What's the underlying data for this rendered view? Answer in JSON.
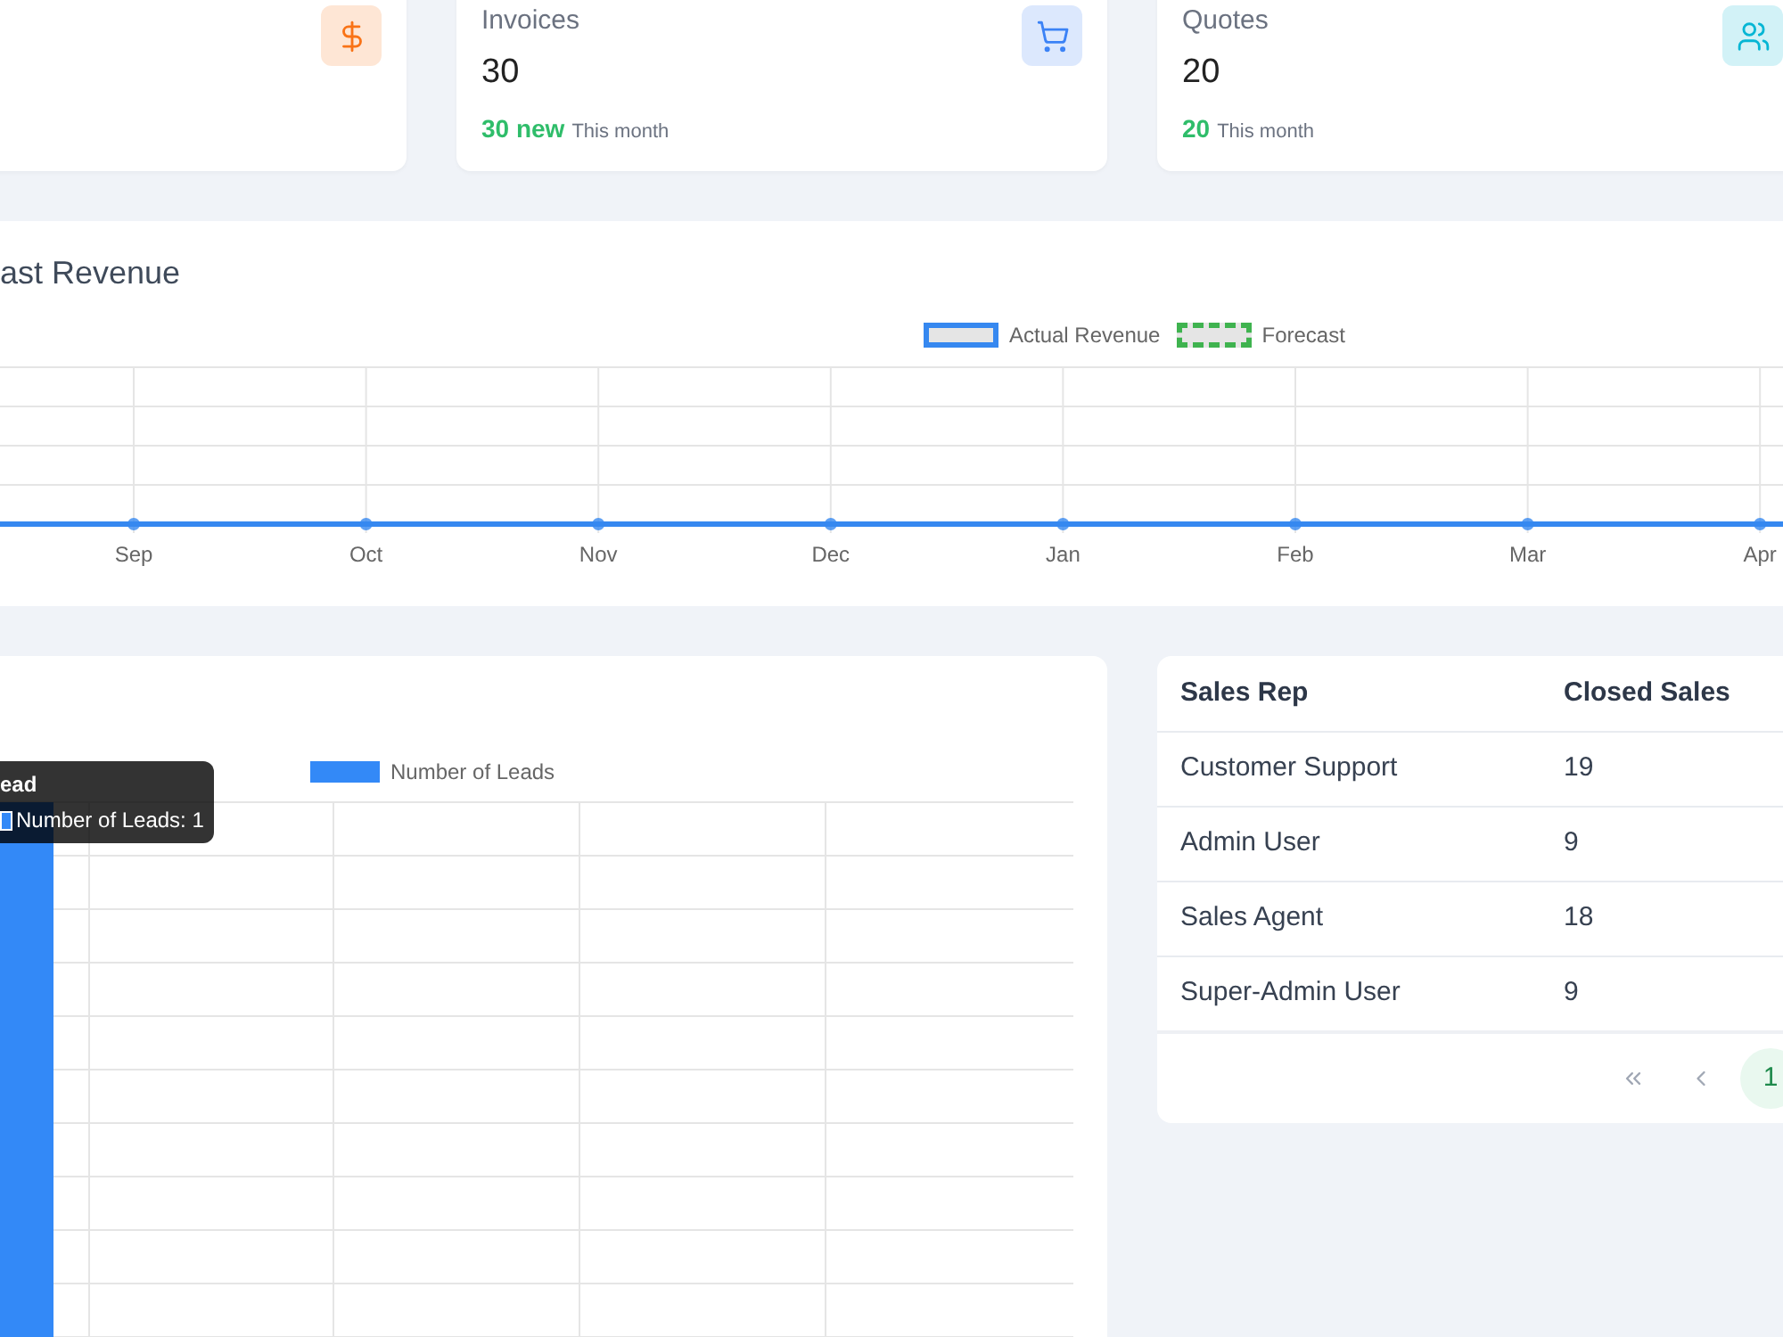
{
  "stat_cards": [
    {
      "color": "#f97316"
    },
    {
      "title": "Invoices",
      "value": "30",
      "change": "30 new",
      "period": "This month",
      "color": "#3b82f6"
    },
    {
      "title": "Quotes",
      "value": "20",
      "change": "20",
      "period": "This month",
      "color": "#06b6d4"
    }
  ],
  "revenue_chart": {
    "title": "ast Revenue",
    "legend": [
      {
        "label": "Actual Revenue",
        "color": "#3688f0",
        "kind": "solid"
      },
      {
        "label": "Forecast",
        "color": "#3fb34f",
        "kind": "dashed"
      }
    ],
    "x_labels": [
      "Sep",
      "Oct",
      "Nov",
      "Dec",
      "Jan",
      "Feb",
      "Mar",
      "Apr"
    ]
  },
  "leads_chart": {
    "legend": [
      {
        "label": "Number of Leads",
        "color": "#3389f7"
      }
    ],
    "tooltip": {
      "title": "ead",
      "text": "Number of Leads: 1"
    }
  },
  "sales_table": {
    "columns": [
      "Sales Rep",
      "Closed Sales"
    ],
    "rows": [
      [
        "Customer Support",
        "19"
      ],
      [
        "Admin User",
        "9"
      ],
      [
        "Sales Agent",
        "18"
      ],
      [
        "Super-Admin User",
        "9"
      ]
    ],
    "pages": [
      {
        "label": "1",
        "selected": true
      }
    ]
  }
}
